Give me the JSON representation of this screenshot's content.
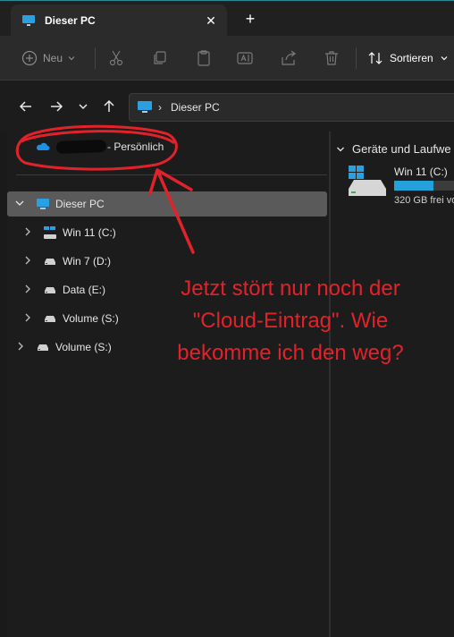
{
  "tab": {
    "title": "Dieser PC",
    "close_glyph": "✕",
    "new_glyph": "+"
  },
  "toolbar": {
    "new_label": "Neu",
    "sort_label": "Sortieren"
  },
  "address": {
    "path": "Dieser PC",
    "separator": "›"
  },
  "nav": {
    "onedrive_suffix": "- Persönlich",
    "items": [
      {
        "label": "Dieser PC"
      },
      {
        "label": "Win 11 (C:)"
      },
      {
        "label": "Win 7 (D:)"
      },
      {
        "label": "Data (E:)"
      },
      {
        "label": "Volume (S:)"
      },
      {
        "label": "Volume (S:)"
      }
    ]
  },
  "content": {
    "group_header": "Geräte und Laufwe",
    "drive": {
      "name": "Win 11 (C:)",
      "free_text": "320 GB frei vo",
      "used_fraction": 0.55
    }
  },
  "annotation": {
    "lines": [
      "Jetzt stört nur noch der",
      "\"Cloud-Eintrag\". Wie",
      "bekomme ich den weg?"
    ]
  },
  "colors": {
    "accent": "#26a0da",
    "annotation_red": "#e2222a",
    "selected_bg": "#5a5a5a"
  }
}
